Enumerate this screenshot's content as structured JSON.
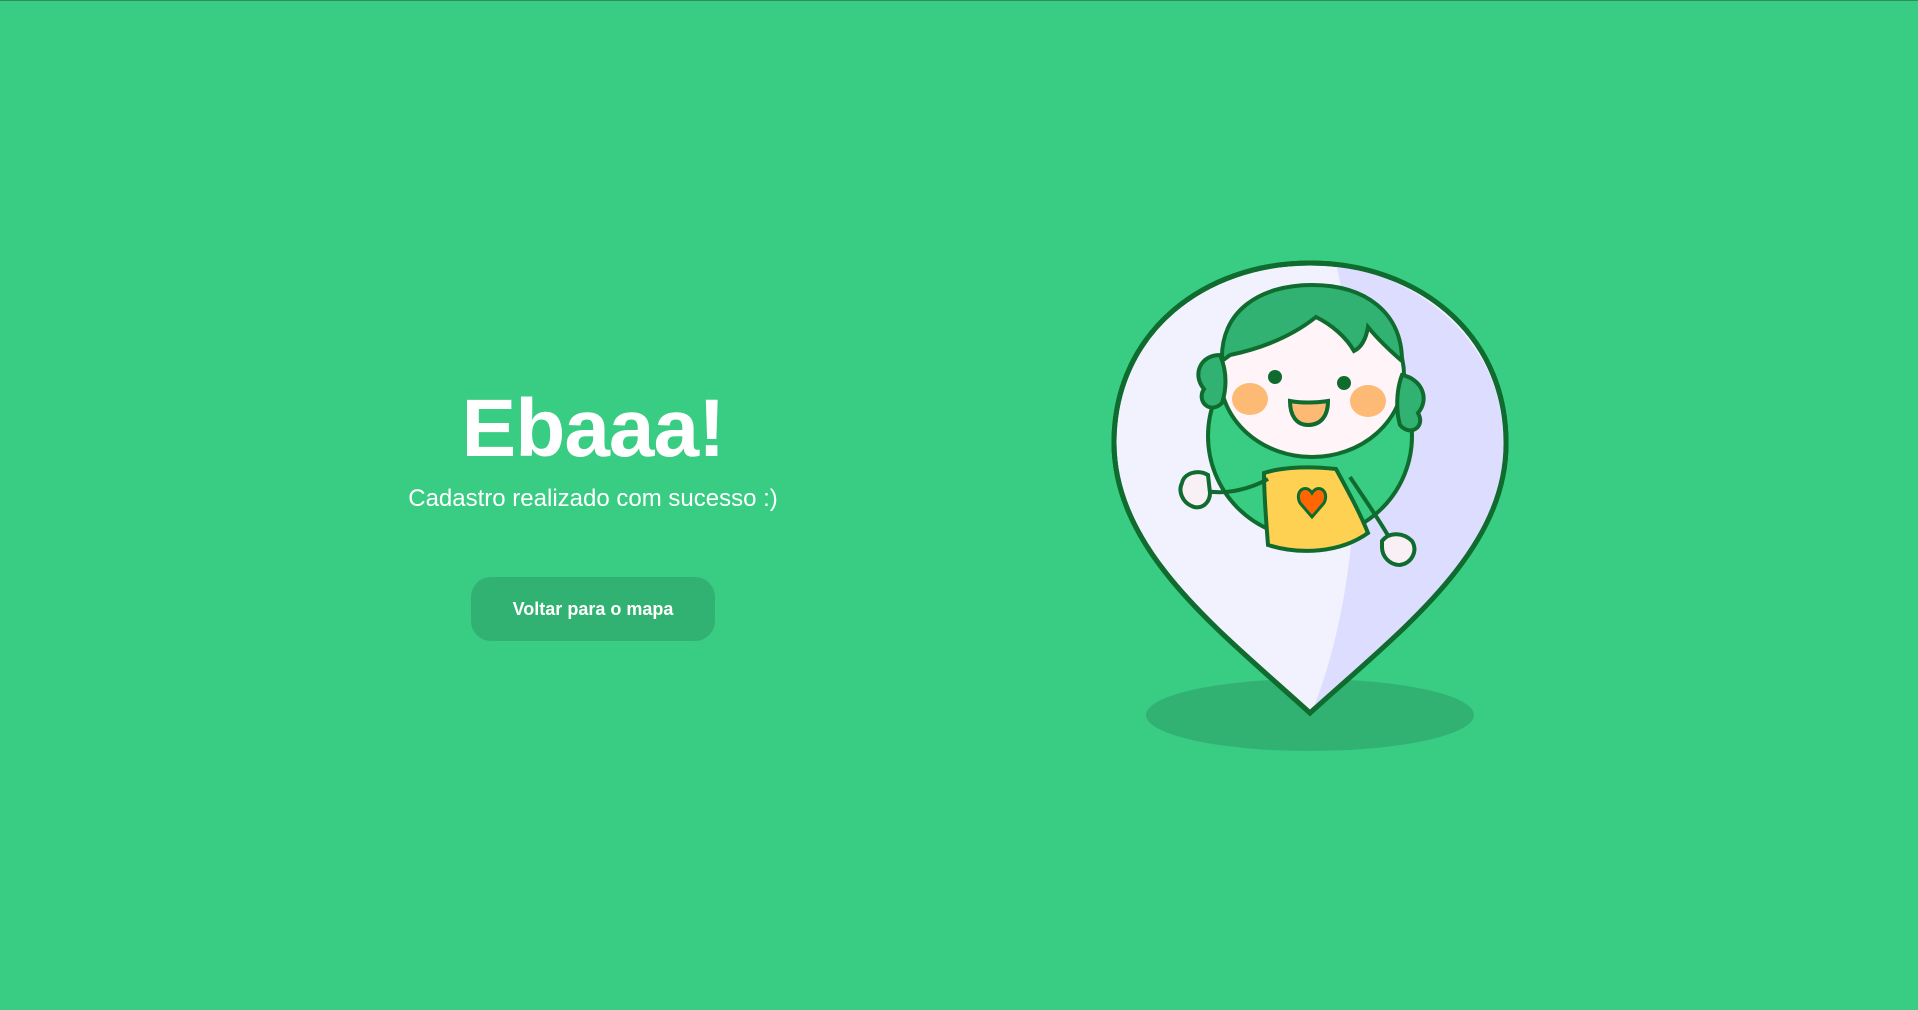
{
  "success": {
    "title": "Ebaaa!",
    "message": "Cadastro realizado com sucesso :)",
    "back_button_label": "Voltar para o mapa"
  },
  "illustration": {
    "icon": "map-pin-girl-waving-illustration"
  },
  "colors": {
    "background": "#39CC83",
    "button": "#31B272",
    "outline": "#0F6C2E",
    "pin_fill": "#F2F2FF",
    "pin_shade": "#DDDDFF"
  }
}
